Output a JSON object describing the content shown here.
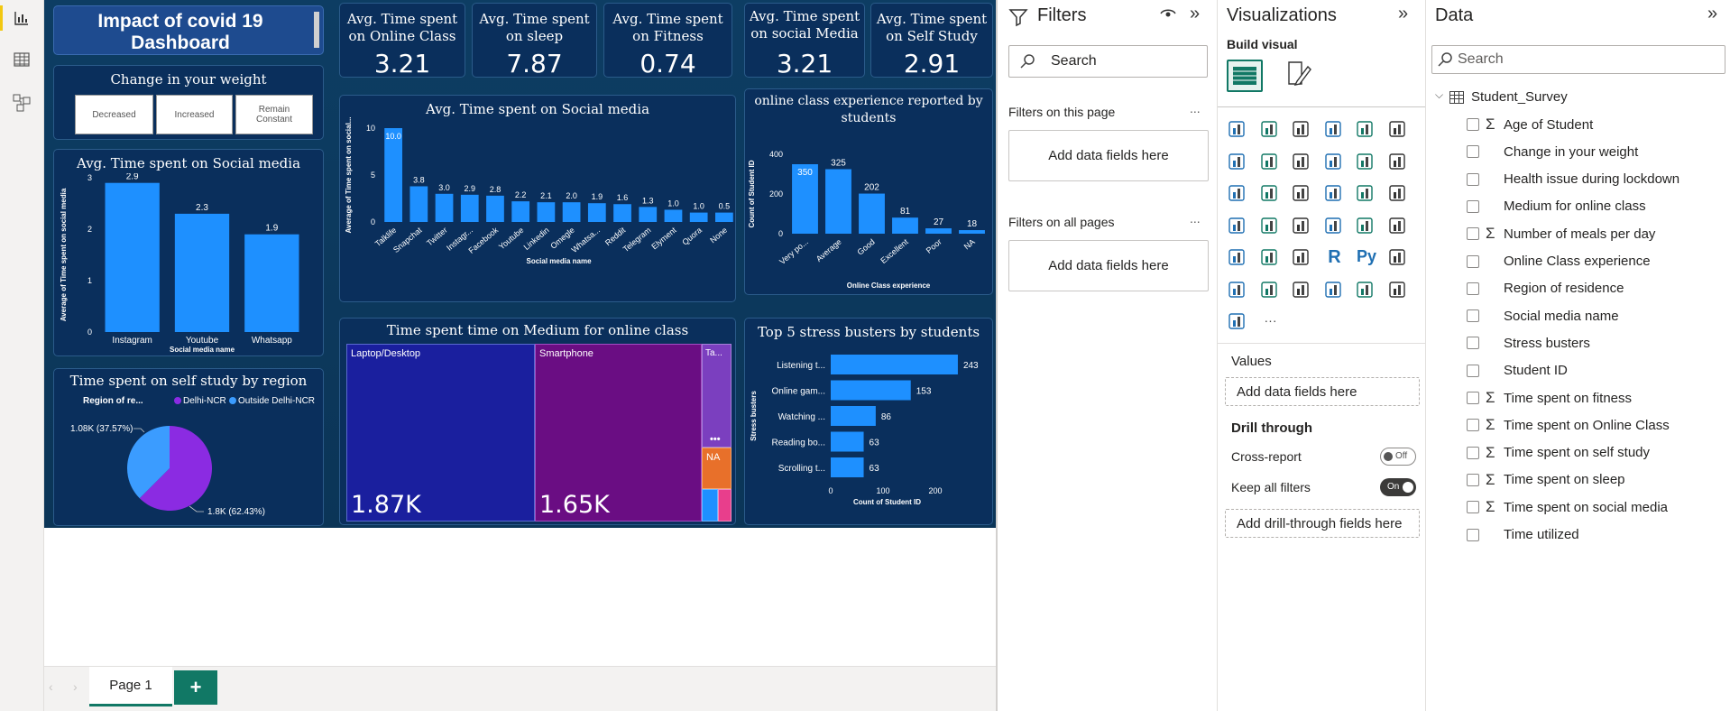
{
  "leftrail": {
    "icons": [
      "report-view-icon",
      "table-view-icon",
      "model-view-icon"
    ]
  },
  "dashboard": {
    "title": "Impact of covid 19 Dashboard",
    "title_line1": "Impact of covid 19",
    "title_line2": "Dashboard",
    "kpis": [
      {
        "label1": "Avg. Time spent",
        "label2": "on Online Class",
        "value": "3.21"
      },
      {
        "label1": "Avg. Time spent",
        "label2": "on sleep",
        "value": "7.87"
      },
      {
        "label1": "Avg. Time spent",
        "label2": "on Fitness",
        "value": "0.74"
      },
      {
        "label1": "Avg. Time spent",
        "label2": "on social Media",
        "value": "3.21"
      },
      {
        "label1": "Avg. Time spent",
        "label2": "on Self Study",
        "value": "2.91"
      }
    ],
    "weight_slicer": {
      "title": "Change in your weight",
      "options": [
        "Decreased",
        "Increased",
        "Remain Constant"
      ]
    },
    "colors": {
      "bar": "#1e90ff",
      "bg": "#0a2f5c",
      "delhi": "#8b2be2",
      "outside": "#3b9cff",
      "laptop": "#1a1f9e",
      "smartphone": "#6a0d83"
    }
  },
  "chart_data": [
    {
      "type": "bar",
      "title": "Avg. Time spent on Social media",
      "categories": [
        "Instagram",
        "Youtube",
        "Whatsapp"
      ],
      "values": [
        2.9,
        2.3,
        1.9
      ],
      "data_labels": [
        "2.9",
        "2.3",
        "1.9"
      ],
      "xlabel": "Social media name",
      "ylabel": "Average of Time spent on social media",
      "yticks": [
        "0",
        "1",
        "2",
        "3"
      ],
      "ylim": [
        0,
        3
      ]
    },
    {
      "type": "bar",
      "title": "Avg. Time spent on Social media",
      "categories": [
        "Talklife",
        "Snapchat",
        "Twitter",
        "Instagr...",
        "Facebook",
        "Youtube",
        "Linkedin",
        "Omegle",
        "Whatsa...",
        "Reddit",
        "Telegram",
        "Elyment",
        "Quora",
        "None"
      ],
      "values": [
        10.0,
        3.8,
        3.0,
        2.9,
        2.8,
        2.2,
        2.1,
        2.1,
        2.0,
        1.9,
        1.6,
        1.3,
        1.0,
        1.0,
        0.5
      ],
      "data_labels": [
        "10.0",
        "3.8",
        "3.0",
        "2.9",
        "2.8",
        "2.2",
        "2.1",
        "2.0",
        "1.9",
        "1.6",
        "1.3",
        "1.0",
        "1.0",
        "0.5"
      ],
      "xlabel": "Social media name",
      "ylabel": "Average of Time spent on social...",
      "yticks": [
        "0",
        "5",
        "10"
      ],
      "ylim": [
        0,
        10
      ]
    },
    {
      "type": "bar",
      "title": "online class experience reported by students",
      "title_line1": "online class experience reported by",
      "title_line2": "students",
      "categories": [
        "Very po...",
        "Average",
        "Good",
        "Excellent",
        "Poor",
        "NA"
      ],
      "values": [
        350,
        325,
        202,
        81,
        27,
        18
      ],
      "data_labels": [
        "350",
        "325",
        "202",
        "81",
        "27",
        "18"
      ],
      "xlabel": "Online Class experience",
      "ylabel": "Count of Student ID",
      "yticks": [
        "0",
        "200",
        "400"
      ],
      "ylim": [
        0,
        400
      ]
    },
    {
      "type": "pie",
      "title": "Time spent on self study by region",
      "legend_title": "Region of re...",
      "legend_position": "top",
      "slices": [
        {
          "name": "Delhi-NCR",
          "value": 1800,
          "label": "1.8K (62.43%)",
          "color": "#8b2be2"
        },
        {
          "name": "Outside Delhi-NCR",
          "value": 1080,
          "label": "1.08K (37.57%)",
          "color": "#3b9cff"
        }
      ]
    },
    {
      "type": "treemap",
      "title": "Time spent time on Medium for online class",
      "items": [
        {
          "name": "Laptop/Desktop",
          "value": 1870,
          "label": "1.87K",
          "color": "#1a1f9e"
        },
        {
          "name": "Smartphone",
          "value": 1650,
          "label": "1.65K",
          "color": "#6a0d83"
        },
        {
          "name": "Ta...",
          "value": 0,
          "label": "",
          "color": "#7b3fbf"
        },
        {
          "name": "NA",
          "value": 0,
          "label": "",
          "color": "#e8702a"
        }
      ]
    },
    {
      "type": "bar",
      "orientation": "horizontal",
      "title": "Top 5 stress busters by students",
      "categories": [
        "Listening t...",
        "Online gam...",
        "Watching ...",
        "Reading bo...",
        "Scrolling t..."
      ],
      "values": [
        243,
        153,
        86,
        63,
        63
      ],
      "data_labels": [
        "243",
        "153",
        "86",
        "63",
        "63"
      ],
      "xlabel": "Count of Student ID",
      "ylabel": "Stress busters",
      "xticks": [
        "0",
        "100",
        "200"
      ],
      "xlim": [
        0,
        250
      ]
    }
  ],
  "tabs": {
    "page_label": "Page 1",
    "add_label": "+"
  },
  "filters": {
    "title": "Filters",
    "search_placeholder": "Search",
    "on_this_page": "Filters on this page",
    "on_all_pages": "Filters on all pages",
    "add_label": "Add data fields here",
    "more": "..."
  },
  "visualizations": {
    "title": "Visualizations",
    "build_visual": "Build visual",
    "values_label": "Values",
    "values_add": "Add data fields here",
    "drill_through": "Drill through",
    "cross_report": "Cross-report",
    "cross_report_state": "Off",
    "keep_all_filters": "Keep all filters",
    "keep_all_state": "On",
    "drill_add": "Add drill-through fields here",
    "more": "···"
  },
  "data_pane": {
    "title": "Data",
    "search_placeholder": "Search",
    "table_name": "Student_Survey",
    "fields": [
      {
        "name": "Age of Student",
        "sigma": true
      },
      {
        "name": "Change in your weight",
        "sigma": false
      },
      {
        "name": "Health issue during lockdown",
        "sigma": false
      },
      {
        "name": "Medium for online class",
        "sigma": false
      },
      {
        "name": "Number of meals per day",
        "sigma": true
      },
      {
        "name": "Online Class experience",
        "sigma": false
      },
      {
        "name": "Region of residence",
        "sigma": false
      },
      {
        "name": "Social media name",
        "sigma": false
      },
      {
        "name": "Stress busters",
        "sigma": false
      },
      {
        "name": "Student ID",
        "sigma": false
      },
      {
        "name": "Time spent on fitness",
        "sigma": true
      },
      {
        "name": "Time spent on Online Class",
        "sigma": true
      },
      {
        "name": "Time spent on self study",
        "sigma": true
      },
      {
        "name": "Time spent on sleep",
        "sigma": true
      },
      {
        "name": "Time spent on social media",
        "sigma": true
      },
      {
        "name": "Time utilized",
        "sigma": false
      }
    ]
  }
}
